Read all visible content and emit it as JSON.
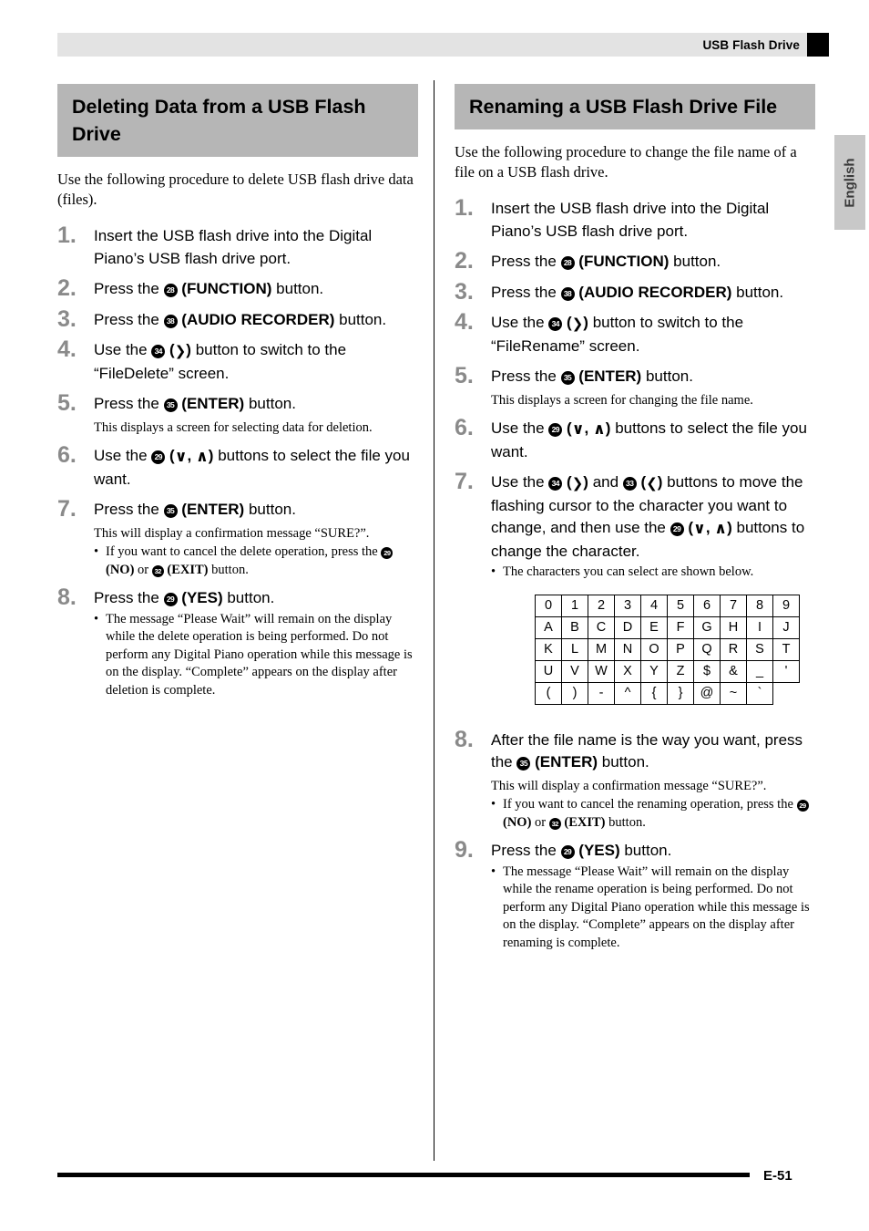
{
  "header": {
    "title": "USB Flash Drive",
    "lang_tab": "English"
  },
  "footer": {
    "page": "E-51"
  },
  "left": {
    "title": "Deleting Data from a USB Flash Drive",
    "intro": "Use the following procedure to delete USB flash drive data (files).",
    "steps": [
      {
        "num": "1.",
        "main_pre": "Insert the USB flash drive into the Digital Piano’s USB flash drive port."
      },
      {
        "num": "2.",
        "main_pre": "Press the ",
        "badge": "28",
        "bold": "(FUNCTION)",
        "main_post": " button."
      },
      {
        "num": "3.",
        "main_pre": "Press the ",
        "badge": "38",
        "bold": "(AUDIO RECORDER)",
        "main_post": " button."
      },
      {
        "num": "4.",
        "main_pre": "Use the ",
        "badge": "34",
        "bold": "(❯)",
        "main_post": " button to switch to the “FileDelete” screen."
      },
      {
        "num": "5.",
        "main_pre": "Press the ",
        "badge": "35",
        "bold": "(ENTER)",
        "main_post": " button.",
        "sub": "This displays a screen for selecting data for deletion."
      },
      {
        "num": "6.",
        "main_pre": "Use the ",
        "badge": "29",
        "bold": "(∨, ∧)",
        "main_post": " buttons to select the file you want."
      },
      {
        "num": "7.",
        "main_pre": "Press the ",
        "badge": "35",
        "bold": "(ENTER)",
        "main_post": " button.",
        "sub": "This will display a confirmation message “SURE?”.",
        "bullet_pre": "If you want to cancel the delete operation, press the ",
        "bullet_badge1": "29",
        "bullet_bold1": "(NO)",
        "bullet_mid": " or ",
        "bullet_badge2": "32",
        "bullet_bold2": "(EXIT)",
        "bullet_post": " button."
      },
      {
        "num": "8.",
        "main_pre": "Press the ",
        "badge": "29",
        "bold": "(YES)",
        "main_post": " button.",
        "bullet_plain": "The message “Please Wait” will remain on the display while the delete operation is being performed. Do not perform any Digital Piano operation while this message is on the display. “Complete” appears on the display after deletion is complete."
      }
    ]
  },
  "right": {
    "title": "Renaming a USB Flash Drive File",
    "intro": "Use the following procedure to change the file name of a file on a USB flash drive.",
    "steps": [
      {
        "num": "1.",
        "main_pre": "Insert the USB flash drive into the Digital Piano’s USB flash drive port."
      },
      {
        "num": "2.",
        "main_pre": "Press the ",
        "badge": "28",
        "bold": "(FUNCTION)",
        "main_post": " button."
      },
      {
        "num": "3.",
        "main_pre": "Press the ",
        "badge": "38",
        "bold": "(AUDIO RECORDER)",
        "main_post": " button."
      },
      {
        "num": "4.",
        "main_pre": "Use the ",
        "badge": "34",
        "bold": "(❯)",
        "main_post": " button to switch to the “FileRename” screen."
      },
      {
        "num": "5.",
        "main_pre": "Press the ",
        "badge": "35",
        "bold": "(ENTER)",
        "main_post": " button.",
        "sub": "This displays a screen for changing the file name."
      },
      {
        "num": "6.",
        "main_pre": "Use the ",
        "badge": "29",
        "bold": "(∨, ∧)",
        "main_post": " buttons to select the file you want."
      },
      {
        "num": "7.",
        "main_pre": "Use the ",
        "badge": "34",
        "bold": "(❯)",
        "main_mid1": " and ",
        "badge2": "33",
        "bold2": "(❮)",
        "main_mid2": " buttons to move the flashing cursor to the character you want to change, and then use the ",
        "badge3": "29",
        "bold3": "(∨, ∧)",
        "main_post": " buttons to change the character.",
        "bullet_plain": "The characters you can select are shown below."
      },
      {
        "num": "8.",
        "main_pre": "After the file name is the way you want, press the ",
        "badge": "35",
        "bold": "(ENTER)",
        "main_post": " button.",
        "sub": "This will display a confirmation message “SURE?”.",
        "bullet_pre": "If you want to cancel the renaming operation, press the ",
        "bullet_badge1": "29",
        "bullet_bold1": "(NO)",
        "bullet_mid": " or ",
        "bullet_badge2": "32",
        "bullet_bold2": "(EXIT)",
        "bullet_post": " button."
      },
      {
        "num": "9.",
        "main_pre": "Press the ",
        "badge": "29",
        "bold": "(YES)",
        "main_post": " button.",
        "bullet_plain": "The message “Please Wait” will remain on the display while the rename operation is being performed. Do not perform any Digital Piano operation while this message is on the display. “Complete” appears on the display after renaming is complete."
      }
    ],
    "character_table": {
      "rows": [
        [
          "0",
          "1",
          "2",
          "3",
          "4",
          "5",
          "6",
          "7",
          "8",
          "9"
        ],
        [
          "A",
          "B",
          "C",
          "D",
          "E",
          "F",
          "G",
          "H",
          "I",
          "J"
        ],
        [
          "K",
          "L",
          "M",
          "N",
          "O",
          "P",
          "Q",
          "R",
          "S",
          "T"
        ],
        [
          "U",
          "V",
          "W",
          "X",
          "Y",
          "Z",
          "$",
          "&",
          "_",
          "'"
        ],
        [
          "(",
          ")",
          "-",
          "^",
          "{",
          "}",
          "@",
          "~",
          "`",
          ""
        ]
      ]
    }
  }
}
